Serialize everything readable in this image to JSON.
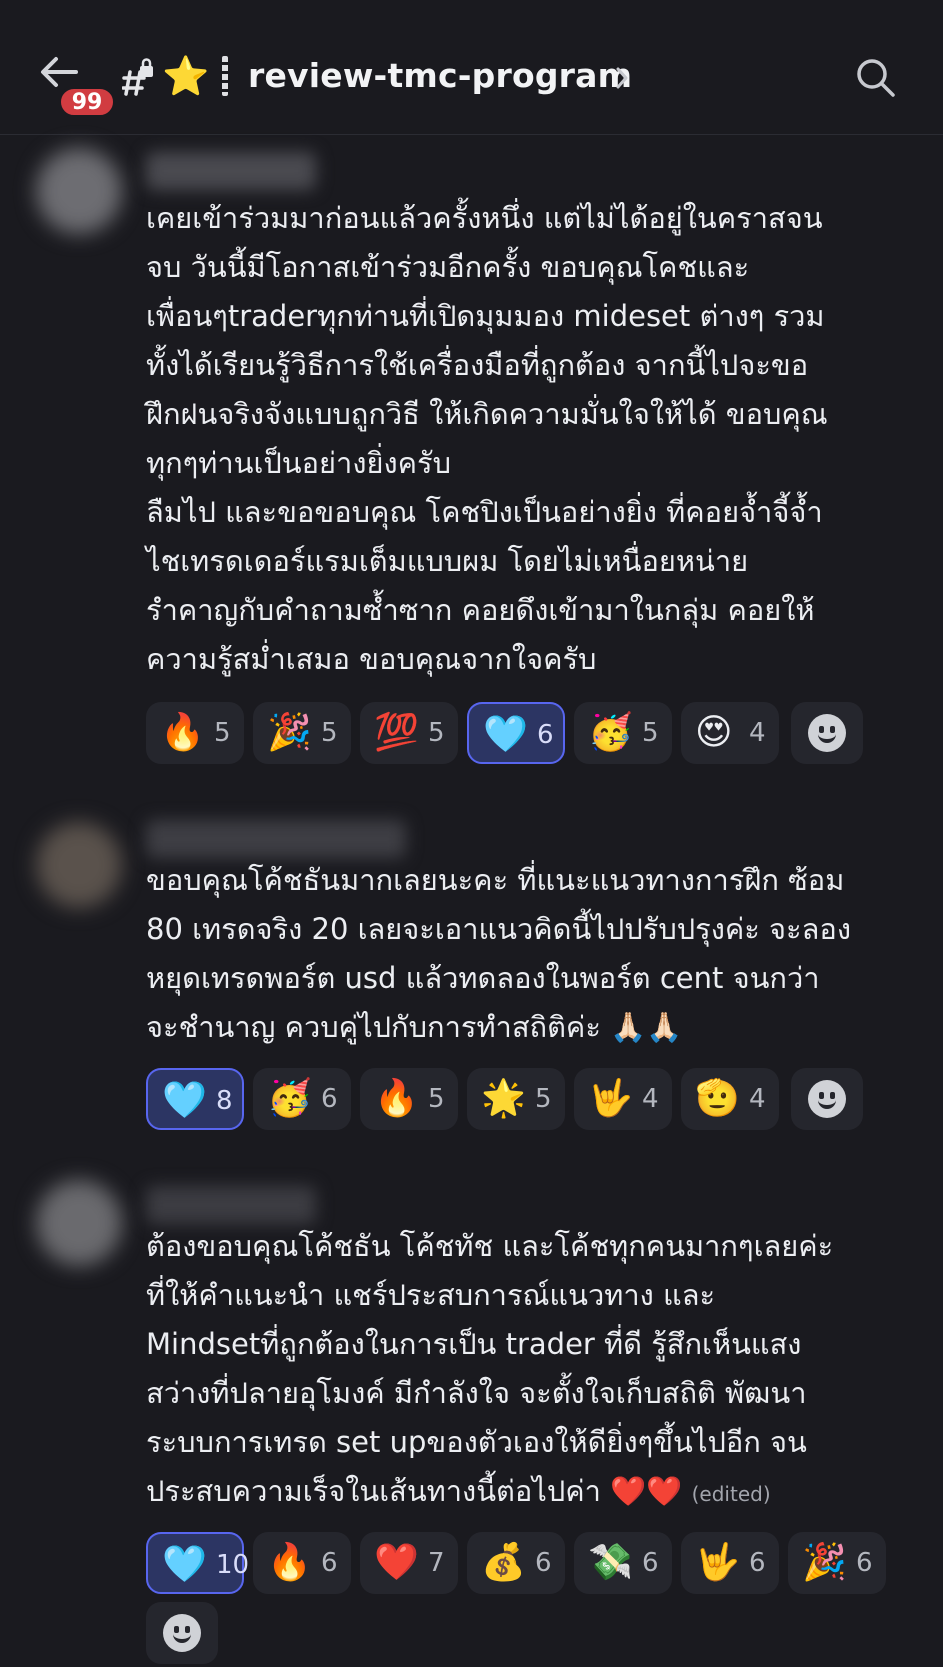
{
  "header": {
    "unread_count": "99",
    "channel_prefix_icon": "hash-lock-icon",
    "channel_emoji": "⭐",
    "channel_name": "review-tmc-program"
  },
  "messages": [
    {
      "lines": [
        "เคยเข้าร่วมมาก่อนแล้วครั้งหนึ่ง แต่ไม่ได้อยู่ในคราสจน",
        "จบ วันนี้มีโอกาสเข้าร่วมอีกครั้ง ขอบคุณโคชและ",
        "เพื่อนๆtraderทุกท่านที่เปิดมุมมอง mideset ต่างๆ รวม",
        "ทั้งได้เรียนรู้วิธีการใช้เครื่องมือที่ถูกต้อง จากนี้ไปจะขอ",
        "ฝึกฝนจริงจังแบบถูกวิธี ให้เกิดความมั่นใจให้ได้ ขอบคุณ",
        "ทุกๆท่านเป็นอย่างยิ่งครับ",
        "ลืมไป และขอขอบคุณ โคชปิงเป็นอย่างยิ่ง ที่คอยจ้ำจี้จ้ำ",
        "ไชเทรดเดอร์แรมเต็มแบบผม โดยไม่เหนื่อยหน่าย",
        "รำคาญกับคำถามซ้ำซาก คอยดึงเข้ามาในกลุ่ม คอยให้",
        "ความรู้สม่ำเสมอ ขอบคุณจากใจครับ"
      ],
      "reactions": [
        {
          "emoji": "🔥",
          "count": "5",
          "active": false
        },
        {
          "emoji": "🎉",
          "count": "5",
          "active": false
        },
        {
          "emoji": "💯",
          "count": "5",
          "active": false
        },
        {
          "emoji": "🩵",
          "count": "6",
          "active": true
        },
        {
          "emoji": "🥳",
          "count": "5",
          "active": false
        },
        {
          "emoji": "😍",
          "count": "4",
          "active": false
        }
      ]
    },
    {
      "lines": [
        "ขอบคุณโค้ชธันมากเลยนะคะ ที่แนะแนวทางการฝึก ซ้อม",
        "80 เทรดจริง 20 เลยจะเอาแนวคิดนี้ไปปรับปรุงค่ะ จะลอง",
        "หยุดเทรดพอร์ต usd แล้วทดลองในพอร์ต cent จนกว่า",
        "จะชำนาญ ควบคู่ไปกับการทำสถิติค่ะ 🙏🏻🙏🏻"
      ],
      "reactions": [
        {
          "emoji": "🩵",
          "count": "8",
          "active": true
        },
        {
          "emoji": "🥳",
          "count": "6",
          "active": false
        },
        {
          "emoji": "🔥",
          "count": "5",
          "active": false
        },
        {
          "emoji": "🌟",
          "count": "5",
          "active": false
        },
        {
          "emoji": "🤟",
          "count": "4",
          "active": false
        },
        {
          "emoji": "🫡",
          "count": "4",
          "active": false
        }
      ]
    },
    {
      "lines": [
        "ต้องขอบคุณโค้ชธัน โค้ชทัช และโค้ชทุกคนมากๆเลยค่ะ",
        "ที่ให้คำแนะนำ แชร์ประสบการณ์แนวทาง และ",
        "Mindsetที่ถูกต้องในการเป็น trader ที่ดี รู้สึกเห็นแสง",
        "สว่างที่ปลายอุโมงค์ มีกำลังใจ จะตั้งใจเก็บสถิติ พัฒนา",
        "ระบบการเทรด set upของตัวเองให้ดียิ่งๆขึ้นไปอีก จน",
        "ประสบความเร็จในเส้นทางนี้ต่อไปค่า ❤️❤️"
      ],
      "edited_label": "(edited)",
      "reactions": [
        {
          "emoji": "🩵",
          "count": "10",
          "active": true
        },
        {
          "emoji": "🔥",
          "count": "6",
          "active": false
        },
        {
          "emoji": "❤️",
          "count": "7",
          "active": false
        },
        {
          "emoji": "💰",
          "count": "6",
          "active": false
        },
        {
          "emoji": "💸",
          "count": "6",
          "active": false
        },
        {
          "emoji": "🤟",
          "count": "6",
          "active": false
        },
        {
          "emoji": "🎉",
          "count": "6",
          "active": false
        }
      ]
    }
  ],
  "icons": {
    "back": "back-arrow-icon",
    "search": "search-icon",
    "add_reaction": "add-reaction-icon",
    "chevron": "chevron-right-icon"
  }
}
